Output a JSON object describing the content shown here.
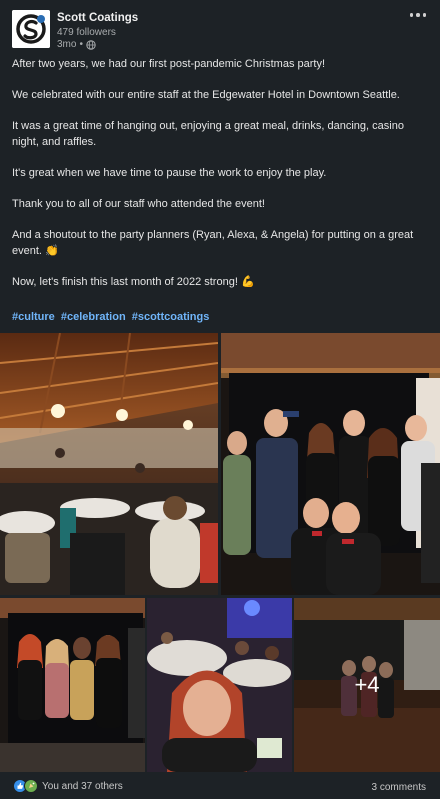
{
  "company": {
    "name": "Scott Coatings",
    "followers": "479 followers",
    "time": "3mo",
    "separator": "•"
  },
  "post": {
    "paragraphs": [
      "After two years, we had our first post-pandemic Christmas party!",
      "We celebrated with our entire staff at the Edgewater Hotel in Downtown Seattle.",
      "It was a great time of hanging out, enjoying a great meal, drinks, dancing, casino night, and raffles.",
      "It's great when we have time to pause the work to enjoy the play.",
      "Thank you to all of our staff who attended the event!",
      "And a shoutout to the party planners (Ryan, Alexa, & Angela) for putting on a great event. 👏",
      "Now, let's finish this last month of 2022 strong! 💪"
    ],
    "hashtags": [
      "#culture",
      "#celebration",
      "#scottcoatings"
    ]
  },
  "photos": {
    "more_count": "+4"
  },
  "footer": {
    "reactions_text": "You and 37 others",
    "comments_text": "3 comments"
  },
  "colors": {
    "background": "#1d2226",
    "hashtag": "#70b5f9",
    "like": "#378fe9",
    "celebrate": "#6dae4f"
  },
  "icons": [
    "more-options-icon",
    "globe-icon",
    "like-reaction-icon",
    "celebrate-reaction-icon"
  ]
}
